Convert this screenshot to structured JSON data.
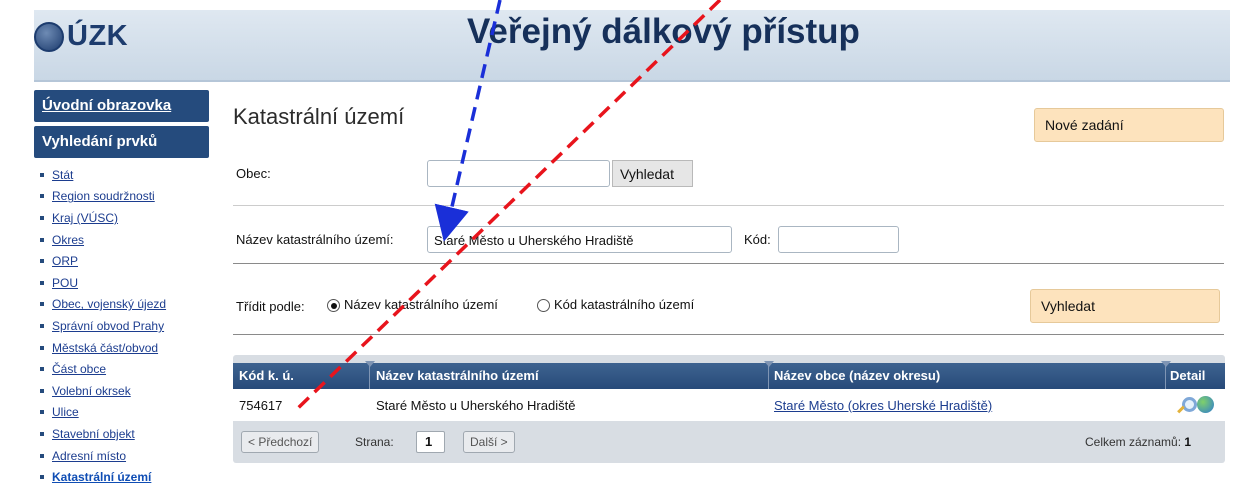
{
  "header": {
    "logo_text": "ÚZK",
    "title": "Veřejný dálkový přístup"
  },
  "sidebar": {
    "home_label": "Úvodní obrazovka",
    "section_label": "Vyhledání prvků",
    "items": [
      {
        "label": "Stát"
      },
      {
        "label": "Region soudržnosti"
      },
      {
        "label": "Kraj (VÚSC)"
      },
      {
        "label": "Okres"
      },
      {
        "label": "ORP"
      },
      {
        "label": "POU"
      },
      {
        "label": "Obec, vojenský újezd"
      },
      {
        "label": "Správní obvod Prahy"
      },
      {
        "label": "Městská část/obvod"
      },
      {
        "label": "Část obce"
      },
      {
        "label": "Volební okrsek"
      },
      {
        "label": "Ulice"
      },
      {
        "label": "Stavební objekt"
      },
      {
        "label": "Adresní místo"
      },
      {
        "label": "Katastrální území",
        "active": true
      }
    ]
  },
  "main": {
    "title": "Katastrální území",
    "new_button": "Nové zadání",
    "obec_label": "Obec:",
    "obec_value": "",
    "obec_search_button": "Vyhledat",
    "ku_name_label": "Název katastrálního území:",
    "ku_name_value": "Staré Město u Uherského Hradiště",
    "kod_label": "Kód:",
    "kod_value": "",
    "sort_label": "Třídit podle:",
    "sort_options": [
      {
        "label": "Název katastrálního území",
        "selected": true
      },
      {
        "label": "Kód katastrálního území",
        "selected": false
      }
    ],
    "search_button": "Vyhledat"
  },
  "table": {
    "columns": [
      "Kód k. ú.",
      "Název katastrálního území",
      "Název obce (název okresu)",
      "Detail"
    ],
    "rows": [
      {
        "kod": "754617",
        "nazev": "Staré Město u Uherského Hradiště",
        "obec": "Staré Město (okres Uherské Hradiště)"
      }
    ],
    "detail_icons": [
      "magnifier-icon",
      "globe-icon"
    ]
  },
  "pagination": {
    "prev_label": "< Předchozí",
    "page_label": "Strana:",
    "page_value": "1",
    "next_label": "Další >",
    "total_label": "Celkem záznamů:",
    "total_value": "1"
  },
  "colors": {
    "header_bg": "#c9d7e5",
    "sidebar_bg": "#254b7d",
    "accent_button": "#fde3bd",
    "table_header": "#274a79",
    "arrow_blue": "#1a2fd8",
    "arrow_red": "#e8141c"
  }
}
